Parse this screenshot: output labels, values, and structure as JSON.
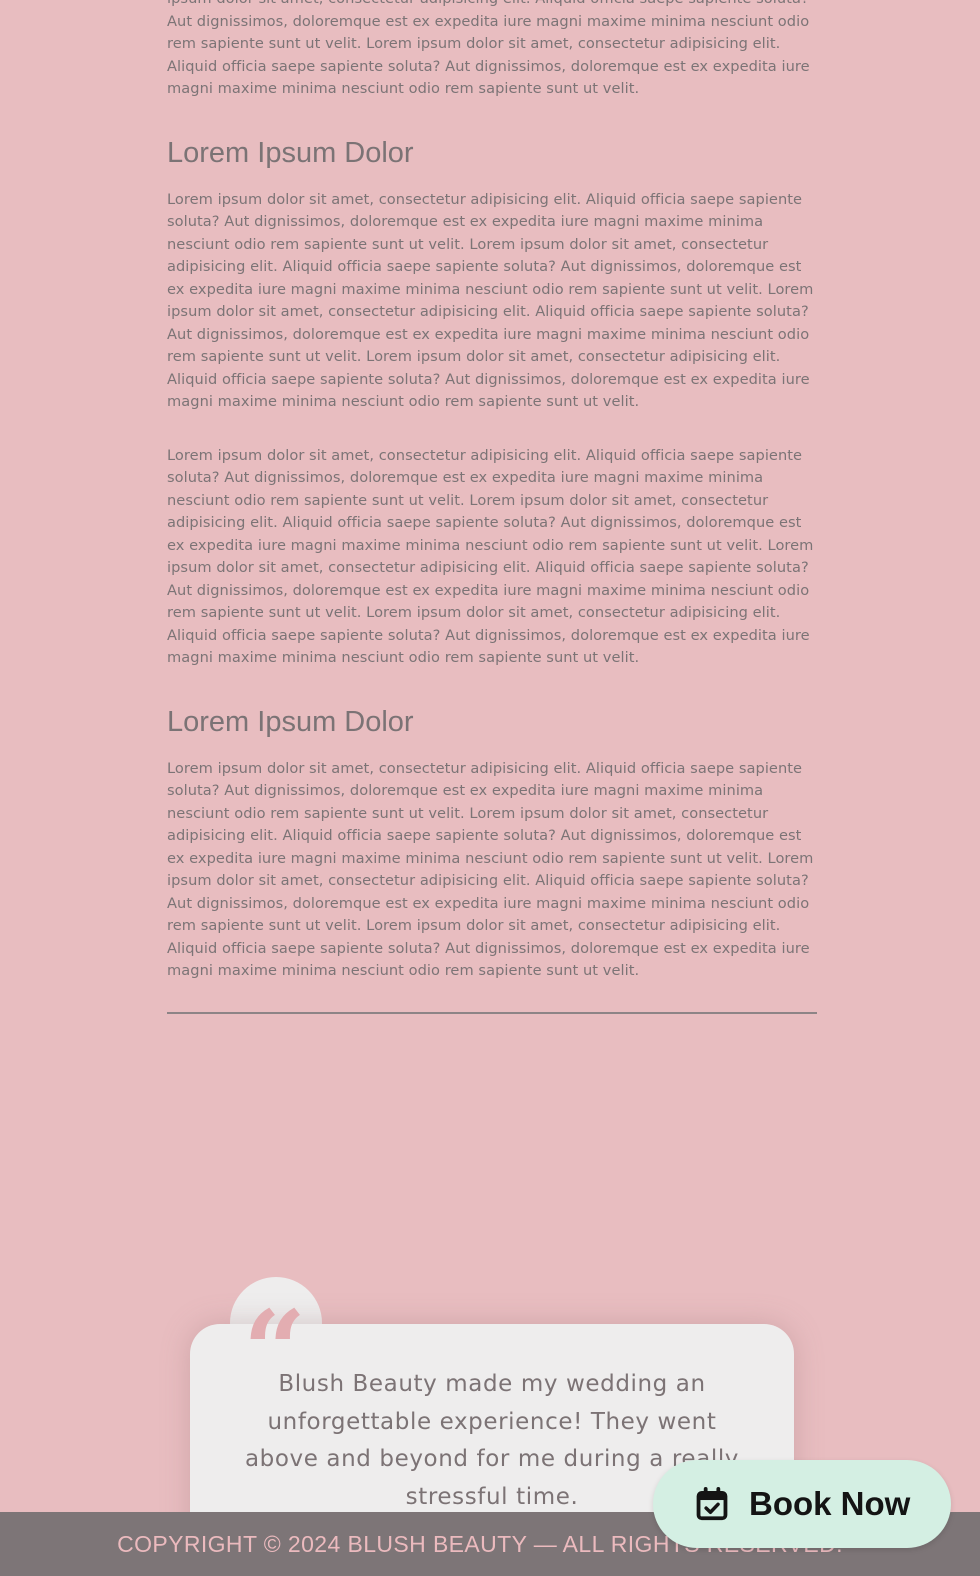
{
  "article": {
    "intro_paragraph": "ipsum dolor sit amet, consectetur adipisicing elit. Aliquid officia saepe sapiente soluta? Aut dignissimos, doloremque est ex expedita iure magni maxime minima nesciunt odio rem sapiente sunt ut velit. Lorem ipsum dolor sit amet, consectetur adipisicing elit. Aliquid officia saepe sapiente soluta? Aut dignissimos, doloremque est ex expedita iure magni maxime minima nesciunt odio rem sapiente sunt ut velit.",
    "sections": [
      {
        "heading": "Lorem Ipsum Dolor",
        "paragraphs": [
          "Lorem ipsum dolor sit amet, consectetur adipisicing elit. Aliquid officia saepe sapiente soluta? Aut dignissimos, doloremque est ex expedita iure magni maxime minima nesciunt odio rem sapiente sunt ut velit. Lorem ipsum dolor sit amet, consectetur adipisicing elit. Aliquid officia saepe sapiente soluta? Aut dignissimos, doloremque est ex expedita iure magni maxime minima nesciunt odio rem sapiente sunt ut velit. Lorem ipsum dolor sit amet, consectetur adipisicing elit. Aliquid officia saepe sapiente soluta? Aut dignissimos, doloremque est ex expedita iure magni maxime minima nesciunt odio rem sapiente sunt ut velit. Lorem ipsum dolor sit amet, consectetur adipisicing elit. Aliquid officia saepe sapiente soluta? Aut dignissimos, doloremque est ex expedita iure magni maxime minima nesciunt odio rem sapiente sunt ut velit.",
          "Lorem ipsum dolor sit amet, consectetur adipisicing elit. Aliquid officia saepe sapiente soluta? Aut dignissimos, doloremque est ex expedita iure magni maxime minima nesciunt odio rem sapiente sunt ut velit. Lorem ipsum dolor sit amet, consectetur adipisicing elit. Aliquid officia saepe sapiente soluta? Aut dignissimos, doloremque est ex expedita iure magni maxime minima nesciunt odio rem sapiente sunt ut velit. Lorem ipsum dolor sit amet, consectetur adipisicing elit. Aliquid officia saepe sapiente soluta? Aut dignissimos, doloremque est ex expedita iure magni maxime minima nesciunt odio rem sapiente sunt ut velit. Lorem ipsum dolor sit amet, consectetur adipisicing elit. Aliquid officia saepe sapiente soluta? Aut dignissimos, doloremque est ex expedita iure magni maxime minima nesciunt odio rem sapiente sunt ut velit."
        ]
      },
      {
        "heading": "Lorem Ipsum Dolor",
        "paragraphs": [
          "Lorem ipsum dolor sit amet, consectetur adipisicing elit. Aliquid officia saepe sapiente soluta? Aut dignissimos, doloremque est ex expedita iure magni maxime minima nesciunt odio rem sapiente sunt ut velit. Lorem ipsum dolor sit amet, consectetur adipisicing elit. Aliquid officia saepe sapiente soluta? Aut dignissimos, doloremque est ex expedita iure magni maxime minima nesciunt odio rem sapiente sunt ut velit. Lorem ipsum dolor sit amet, consectetur adipisicing elit. Aliquid officia saepe sapiente soluta? Aut dignissimos, doloremque est ex expedita iure magni maxime minima nesciunt odio rem sapiente sunt ut velit. Lorem ipsum dolor sit amet, consectetur adipisicing elit. Aliquid officia saepe sapiente soluta? Aut dignissimos, doloremque est ex expedita iure magni maxime minima nesciunt odio rem sapiente sunt ut velit."
        ]
      }
    ]
  },
  "testimonial": {
    "quote_icon": "quote-icon",
    "quote_text": "Blush Beauty made my wedding an unforgettable experience! They went above and beyond for me during a really stressful time."
  },
  "footer": {
    "copyright": "COPYRIGHT © 2024 BLUSH BEAUTY — ALL RIGHTS RESERVED."
  },
  "book_button": {
    "label": "Book Now",
    "icon": "calendar-check-icon"
  },
  "colors": {
    "page_background": "#e8bdc0",
    "card_background": "#eeeded",
    "quote_mark": "#e3adb1",
    "footer_background": "#7d7577",
    "footer_text": "#ebbabe",
    "book_button_background": "#d4efe3"
  }
}
